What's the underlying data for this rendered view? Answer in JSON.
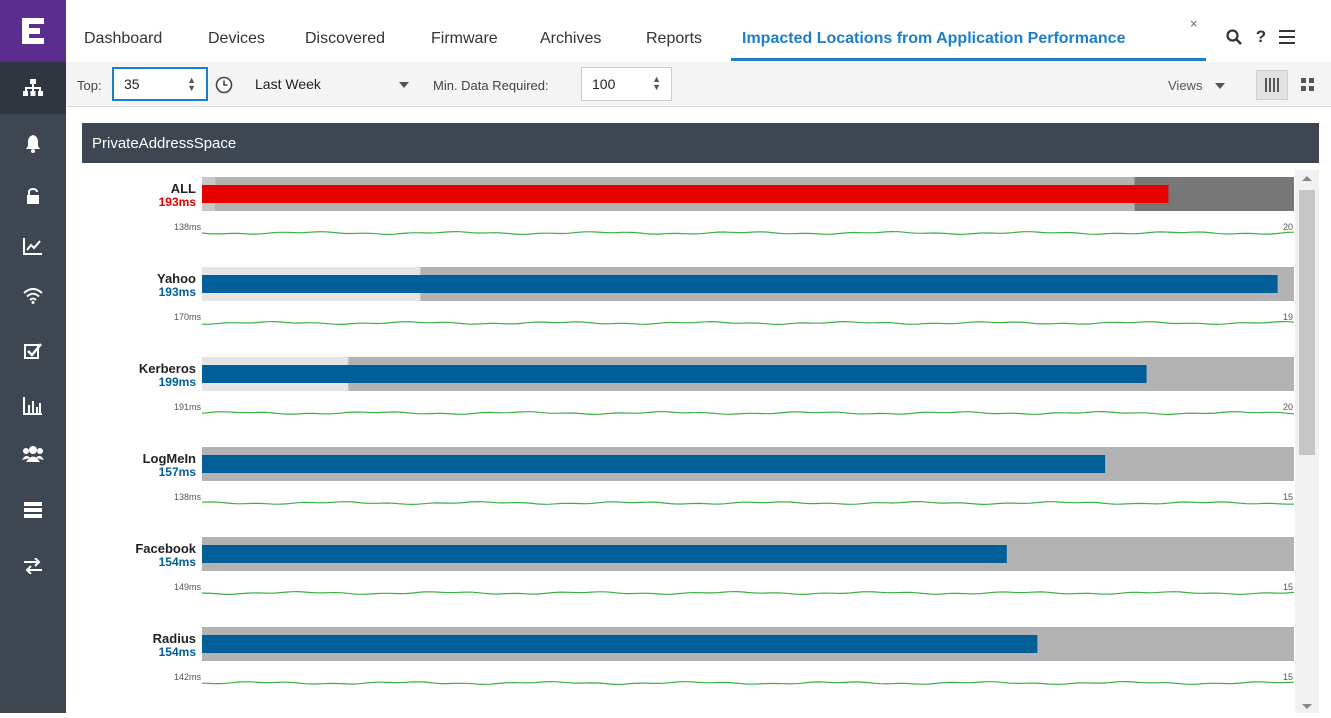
{
  "tabs": [
    {
      "label": "Dashboard",
      "active": false
    },
    {
      "label": "Devices",
      "active": false
    },
    {
      "label": "Discovered",
      "active": false
    },
    {
      "label": "Firmware",
      "active": false
    },
    {
      "label": "Archives",
      "active": false
    },
    {
      "label": "Reports",
      "active": false
    },
    {
      "label": "Impacted Locations from Application Performance",
      "active": true
    }
  ],
  "tab_close_glyph": "×",
  "header_icons": {
    "search": "search-icon",
    "help": "?",
    "menu": "hamburger-icon"
  },
  "sidebar_icons": [
    "network-tree-icon",
    "bell-icon",
    "unlock-icon",
    "trend-chart-icon",
    "wifi-icon",
    "checkbox-icon",
    "bar-chart-icon",
    "users-icon",
    "server-icon",
    "transfer-arrows-icon"
  ],
  "toolbar": {
    "top_label": "Top:",
    "top_value": "35",
    "time_range": "Last Week",
    "min_data_label": "Min. Data Required:",
    "min_data_value": "100",
    "views_label": "Views"
  },
  "panel": {
    "title": "PrivateAddressSpace"
  },
  "colors": {
    "accent": "#1e7ec8",
    "bar_blue": "#005f99",
    "bar_red": "#e60000",
    "sidebar": "#3e4651",
    "logo": "#5b2d8e",
    "sparkline": "#3cb043"
  },
  "chart_data": {
    "type": "bar",
    "rows": [
      {
        "name": "ALL",
        "value": "193ms",
        "min": "138ms",
        "max": "20",
        "fill": 0.885,
        "alert": true
      },
      {
        "name": "Yahoo",
        "value": "193ms",
        "min": "170ms",
        "max": "19",
        "fill": 0.985,
        "alert": false
      },
      {
        "name": "Kerberos",
        "value": "199ms",
        "min": "191ms",
        "max": "20",
        "fill": 0.865,
        "alert": false
      },
      {
        "name": "LogMeIn",
        "value": "157ms",
        "min": "138ms",
        "max": "15",
        "fill": 0.827,
        "alert": false
      },
      {
        "name": "Facebook",
        "value": "154ms",
        "min": "149ms",
        "max": "15",
        "fill": 0.737,
        "alert": false
      },
      {
        "name": "Radius",
        "value": "154ms",
        "min": "142ms",
        "max": "15",
        "fill": 0.765,
        "alert": false
      }
    ]
  }
}
